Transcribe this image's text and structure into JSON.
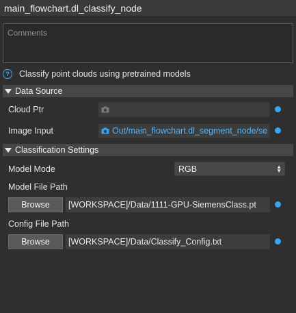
{
  "node_title": "main_flowchart.dl_classify_node",
  "comments": {
    "placeholder": "Comments"
  },
  "description": "Classify point clouds using pretrained models",
  "data_source": {
    "header": "Data Source",
    "cloud_ptr": {
      "label": "Cloud Ptr",
      "value": ""
    },
    "image_input": {
      "label": "Image Input",
      "value": "Out/main_flowchart.dl_segment_node/se"
    }
  },
  "classification": {
    "header": "Classification Settings",
    "model_mode": {
      "label": "Model Mode",
      "value": "RGB"
    },
    "model_file": {
      "label": "Model File Path",
      "button": "Browse",
      "value": "[WORKSPACE]/Data/1111-GPU-SiemensClass.pt"
    },
    "config_file": {
      "label": "Config File Path",
      "button": "Browse",
      "value": "[WORKSPACE]/Data/Classify_Config.txt"
    }
  },
  "colors": {
    "accent": "#3aa3ee",
    "link": "#5ab2ee",
    "background": "#2f2f2f"
  }
}
